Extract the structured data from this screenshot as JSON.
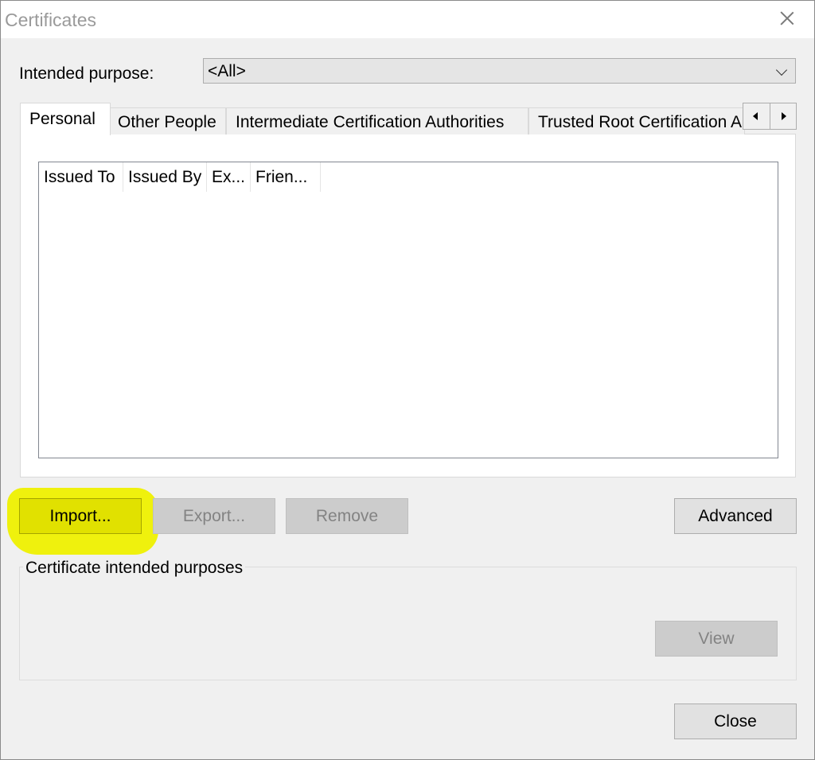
{
  "window": {
    "title": "Certificates"
  },
  "purpose": {
    "label": "Intended purpose:",
    "selected": "<All>"
  },
  "tabs": [
    {
      "label": "Personal",
      "active": true
    },
    {
      "label": "Other People",
      "active": false
    },
    {
      "label": "Intermediate Certification Authorities",
      "active": false
    },
    {
      "label": "Trusted Root Certification Authorities",
      "active": false
    }
  ],
  "list": {
    "columns": [
      "Issued To",
      "Issued By",
      "Ex...",
      "Frien..."
    ],
    "rows": []
  },
  "buttons": {
    "import": "Import...",
    "export": "Export...",
    "remove": "Remove",
    "advanced": "Advanced",
    "view": "View",
    "close": "Close"
  },
  "purposes_group": {
    "label": "Certificate intended purposes"
  },
  "colors": {
    "highlight": "#eef000",
    "disabled_button": "#cccccc"
  },
  "icons": [
    "close-icon",
    "chevron-down-icon",
    "scroll-left-icon",
    "scroll-right-icon"
  ]
}
